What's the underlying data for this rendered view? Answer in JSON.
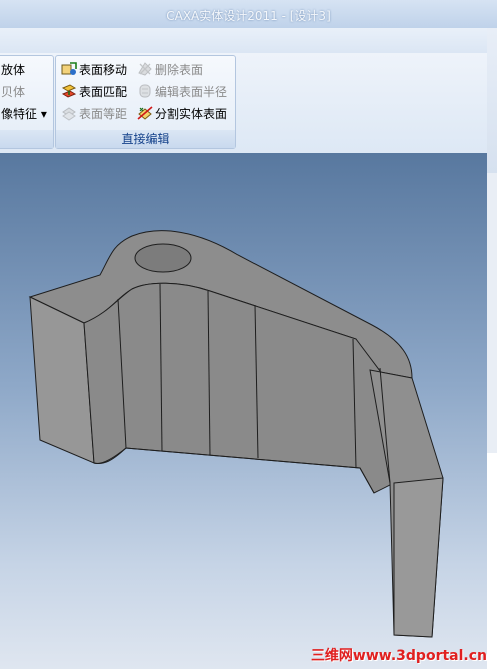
{
  "window": {
    "title": "CAXA实体设计2011 - [设计3]"
  },
  "ribbon": {
    "left_group_partial": {
      "items": [
        {
          "label": "放体",
          "enabled": true,
          "icon": ""
        },
        {
          "label": "贝体",
          "enabled": false,
          "icon": ""
        },
        {
          "label": "像特征 ▾",
          "enabled": true,
          "icon": ""
        }
      ]
    },
    "direct_edit_group": {
      "caption": "直接编辑",
      "items": [
        {
          "label": "表面移动",
          "enabled": true,
          "icon": "face-move-icon"
        },
        {
          "label": "删除表面",
          "enabled": false,
          "icon": "delete-face-icon"
        },
        {
          "label": "表面匹配",
          "enabled": true,
          "icon": "face-match-icon"
        },
        {
          "label": "编辑表面半径",
          "enabled": false,
          "icon": "edit-face-radius-icon"
        },
        {
          "label": "表面等距",
          "enabled": false,
          "icon": "face-offset-icon"
        },
        {
          "label": "分割实体表面",
          "enabled": true,
          "icon": "split-solid-face-icon"
        }
      ]
    }
  },
  "viewport": {
    "background_top": "#58789f",
    "background_bottom": "#dfe6f0",
    "model_color": "#8f8f8f"
  },
  "watermark": "三维网www.3dportal.cn"
}
